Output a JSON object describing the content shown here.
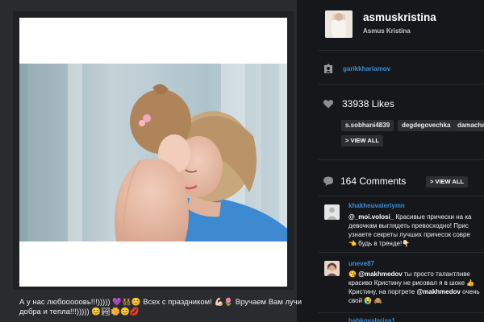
{
  "post": {
    "caption_line1": "А у нас любооооовь!!!))))) 💜👯😊 Всех с праздником! 💪🏻🌷 Вручаем Вам лучи",
    "caption_line2": "добра и тепла!!!))))) 😊🏞🌼😊💋"
  },
  "profile": {
    "username": "asmuskristina",
    "full_name": "Asmus Kristina",
    "avatar_icon": "profile-photo"
  },
  "tagged": {
    "icon": "tag-person-icon",
    "user": "garikkharlamov"
  },
  "likes": {
    "icon": "heart-icon",
    "count_text": "33938 Likes",
    "likers": [
      "s.sobhani4839",
      "degdegovechka",
      "damacha"
    ],
    "view_all": "> VIEW ALL"
  },
  "comments": {
    "icon": "comment-bubble-icon",
    "count_text": "164 Comments",
    "view_all": "> VIEW ALL",
    "items": [
      {
        "author": "khakheuvaleriymn",
        "mention": "@_moi.volosi_",
        "line1_rest": " Красивые прически на ка",
        "line2": "девочкам выглядеть превосходно! Прис",
        "line3": "узнаете секреты лучших причесок совре",
        "line4": "👈 будь в тренде!👇🏻"
      },
      {
        "author": "uneve87",
        "line1_prefix": "😘 ",
        "mention": "@makhmedov",
        "line1_rest": " ты просто талантливе",
        "line2": "красиво Кристину не рисовал я в шоке 👍",
        "line3_prefix": "Кристину, на портрете ",
        "mention2": "@makhmedov",
        "line3_rest": " очень",
        "line4": "свой 😭 🙈"
      },
      {
        "author": "babkovaIarisa1"
      }
    ]
  },
  "colors": {
    "background": "#16171a",
    "panel": "#2a2b2e",
    "link": "#3a8fd6",
    "chip": "#2d2e32"
  }
}
